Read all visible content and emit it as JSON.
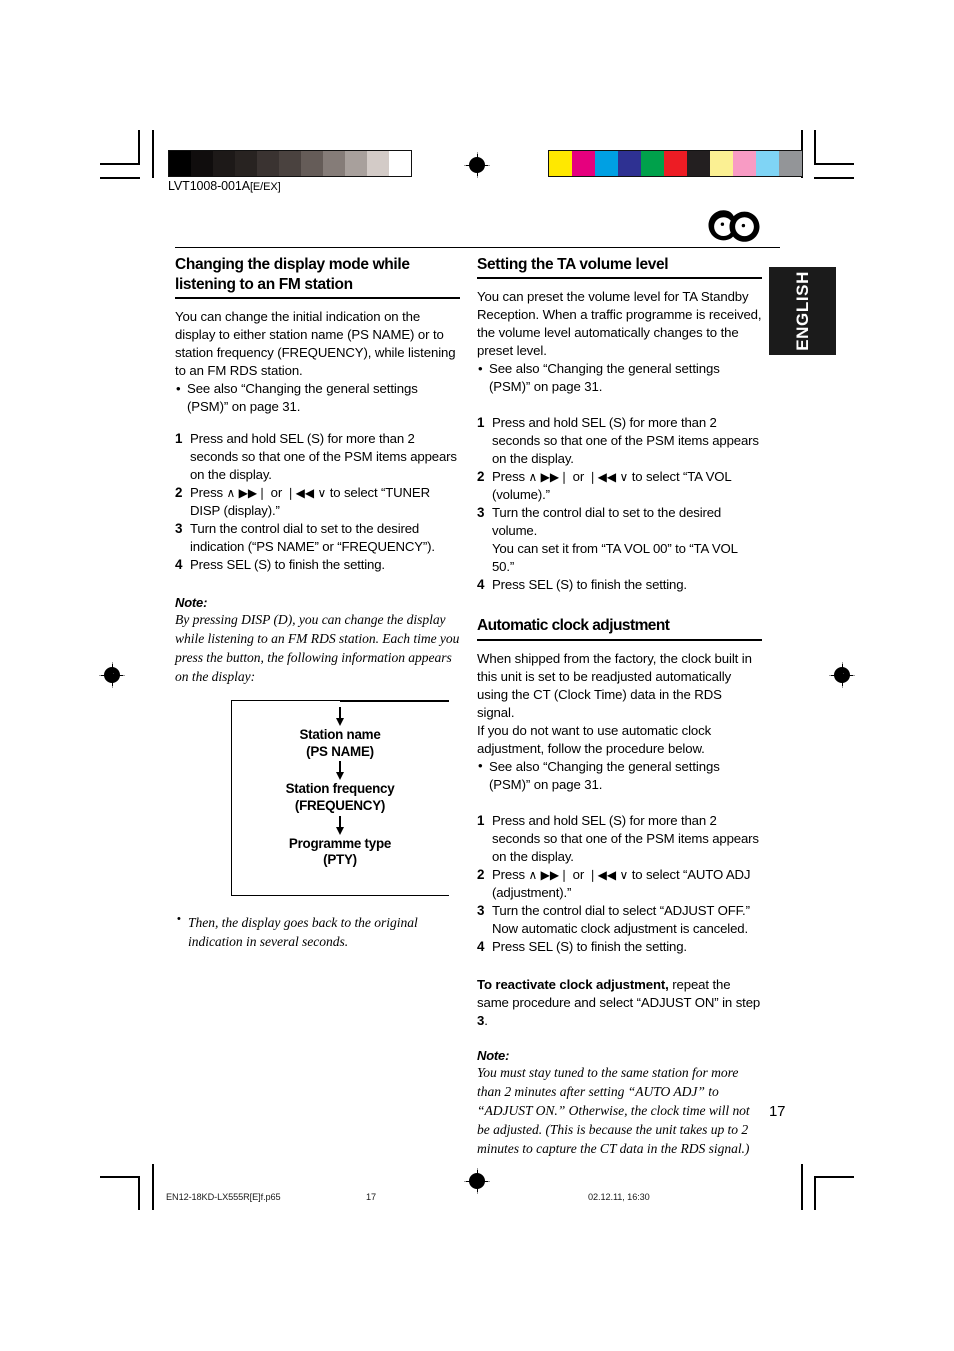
{
  "document": {
    "code": "LVT1008-001A",
    "code_suffix": "[E/EX]",
    "page_number": "17",
    "language_tab": "ENGLISH",
    "logo_name": "rds-double-circle-logo"
  },
  "footer": {
    "filename": "EN12-18KD-LX555R[E]f.p65",
    "page": "17",
    "timestamp": "02.12.11, 16:30"
  },
  "calibration": {
    "grayscale": [
      "#000000",
      "#100d0d",
      "#1d1918",
      "#282321",
      "#3a3331",
      "#4a423f",
      "#655c58",
      "#857c78",
      "#a8a09c",
      "#d3cbc7",
      "#ffffff"
    ],
    "color": [
      "#ffe800",
      "#e6007e",
      "#00a0e3",
      "#2e3192",
      "#00a14b",
      "#ed1c24",
      "#231f20",
      "#fbf093",
      "#f89bc4",
      "#7fd4f5",
      "#939598"
    ]
  },
  "left_column": {
    "section1": {
      "heading": "Changing the display mode while listening to an FM station",
      "intro": "You can change the initial indication on the display to either station name (PS NAME) or to station frequency (FREQUENCY), while listening to an FM RDS station.",
      "bullets": [
        "See also “Changing the general settings (PSM)” on page 31."
      ],
      "steps": [
        {
          "num": "1",
          "text": "Press and hold SEL (S) for more than 2 seconds so that one of the PSM items appears on the display."
        },
        {
          "num": "2",
          "pre": "Press ",
          "glyph1": "∧ ▶▶❘",
          "mid": " or ",
          "glyph2": "❘◀◀ ∨",
          "post": " to select “TUNER DISP (display).”"
        },
        {
          "num": "3",
          "text": "Turn the control dial to set to the desired indication (“PS NAME” or “FREQUENCY”)."
        },
        {
          "num": "4",
          "text": "Press SEL (S) to finish the setting."
        }
      ],
      "note_label": "Note:",
      "note_body": "By pressing DISP (D), you can change the display while listening to an FM RDS station. Each time you press the button, the following information appears on the display:",
      "after_note_bullets": [
        "Then, the display goes back to the original indication in several seconds."
      ]
    },
    "flow_diagram": {
      "name": "display-mode-cycle-diagram",
      "items": [
        {
          "line1": "Station name",
          "line2": "(PS NAME)"
        },
        {
          "line1": "Station frequency",
          "line2": "(FREQUENCY)"
        },
        {
          "line1": "Programme type",
          "line2": "(PTY)"
        }
      ]
    }
  },
  "right_column": {
    "section2": {
      "heading": "Setting the TA volume level",
      "intro": "You can preset the volume level for TA Standby Reception. When a traffic programme is received, the volume level automatically changes to the preset level.",
      "bullets": [
        "See also “Changing the general settings (PSM)” on page 31."
      ],
      "steps": [
        {
          "num": "1",
          "text": "Press and hold SEL (S) for more than 2 seconds so that one of the PSM items appears on the display."
        },
        {
          "num": "2",
          "pre": "Press ",
          "glyph1": "∧ ▶▶❘",
          "mid": " or ",
          "glyph2": "❘◀◀ ∨",
          "post": " to select “TA VOL (volume).”"
        },
        {
          "num": "3",
          "text": "Turn the control dial to set to the desired volume.",
          "sub": "You can set it from “TA VOL 00” to “TA VOL 50.”"
        },
        {
          "num": "4",
          "text": "Press SEL (S) to finish the setting."
        }
      ]
    },
    "section3": {
      "heading": "Automatic clock adjustment",
      "intro": "When shipped from the factory, the clock built in this unit is set to be readjusted automatically using the CT (Clock Time) data in the RDS signal.",
      "intro2": "If you do not want to use automatic clock adjustment, follow the procedure below.",
      "bullets": [
        "See also “Changing the general settings (PSM)” on page 31."
      ],
      "steps": [
        {
          "num": "1",
          "text": "Press and hold SEL (S) for more than 2 seconds so that one of the PSM items appears on the display."
        },
        {
          "num": "2",
          "pre": "Press ",
          "glyph1": "∧ ▶▶❘",
          "mid": " or ",
          "glyph2": "❘◀◀ ∨",
          "post": " to select “AUTO ADJ (adjustment).”"
        },
        {
          "num": "3",
          "text": "Turn the control dial to select “ADJUST OFF.”",
          "sub": "Now automatic clock adjustment is canceled."
        },
        {
          "num": "4",
          "text": "Press SEL (S) to finish the setting."
        }
      ],
      "reactivate_bold": "To reactivate clock adjustment,",
      "reactivate_rest": " repeat the same procedure and select “ADJUST ON” in step ",
      "reactivate_step": "3",
      "reactivate_end": ".",
      "note_label": "Note:",
      "note_body": "You must stay tuned to the same station for more than 2 minutes after setting “AUTO ADJ” to “ADJUST ON.” Otherwise, the clock time will not be adjusted. (This is because the unit takes up to 2 minutes to capture the CT data in the RDS signal.)"
    }
  }
}
